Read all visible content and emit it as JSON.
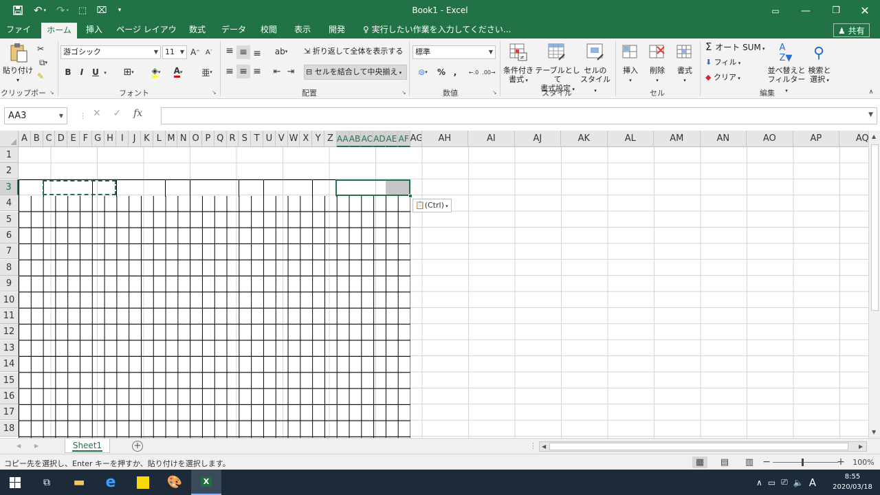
{
  "titlebar": {
    "title": "Book1 - Excel"
  },
  "tabs": [
    {
      "label": "ファイル",
      "active": false
    },
    {
      "label": "ホーム",
      "active": true
    },
    {
      "label": "挿入",
      "active": false
    },
    {
      "label": "ページ レイアウト",
      "active": false
    },
    {
      "label": "数式",
      "active": false
    },
    {
      "label": "データ",
      "active": false
    },
    {
      "label": "校閲",
      "active": false
    },
    {
      "label": "表示",
      "active": false
    },
    {
      "label": "開発",
      "active": false
    }
  ],
  "tellme": "実行したい作業を入力してください...",
  "share": "共有",
  "ribbon": {
    "clipboard": {
      "paste": "貼り付け",
      "label": "クリップボード"
    },
    "font": {
      "name": "游ゴシック",
      "size": "11",
      "label": "フォント",
      "bold": "B",
      "italic": "I",
      "underline": "U"
    },
    "alignment": {
      "wrap": "折り返して全体を表示する",
      "merge": "セルを結合して中央揃え",
      "label": "配置"
    },
    "number": {
      "format": "標準",
      "percent": "%",
      "comma": ",",
      "label": "数値"
    },
    "styles": {
      "conditional": [
        "条件付き",
        "書式"
      ],
      "as_table": [
        "テーブルとして",
        "書式設定"
      ],
      "cell_styles": [
        "セルの",
        "スタイル"
      ],
      "label": "スタイル"
    },
    "cells": {
      "insert": "挿入",
      "delete": "削除",
      "format": "書式",
      "label": "セル"
    },
    "editing": {
      "autosum": "オート SUM",
      "fill": "フィル",
      "clear": "クリア",
      "sort": [
        "並べ替えと",
        "フィルター"
      ],
      "find": [
        "検索と",
        "選択"
      ],
      "label": "編集"
    }
  },
  "formula_bar": {
    "name_box": "AA3",
    "fx": "fx",
    "value": ""
  },
  "columns": [
    "A",
    "B",
    "C",
    "D",
    "E",
    "F",
    "G",
    "H",
    "I",
    "J",
    "K",
    "L",
    "M",
    "N",
    "O",
    "P",
    "Q",
    "R",
    "S",
    "T",
    "U",
    "V",
    "W",
    "X",
    "Y",
    "Z",
    "AA",
    "AB",
    "AC",
    "AD",
    "AE",
    "AF",
    "AG",
    "AH",
    "AI",
    "AJ",
    "AK",
    "AL",
    "AM",
    "AN",
    "AO",
    "AP",
    "AQ"
  ],
  "selected_columns": [
    "AA",
    "AB",
    "AC",
    "AD",
    "AE",
    "AF"
  ],
  "rows": [
    "1",
    "2",
    "3",
    "4",
    "5",
    "6",
    "7",
    "8",
    "9",
    "10",
    "11",
    "12",
    "13",
    "14",
    "15",
    "16",
    "17",
    "18"
  ],
  "paste_options": "(Ctrl)",
  "sheet_tab": "Sheet1",
  "status": {
    "message": "コピー先を選択し、Enter キーを押すか、貼り付けを選択します。",
    "zoom": "100%"
  },
  "taskbar": {
    "time": "8:55",
    "date": "2020/03/18",
    "ime": "A"
  }
}
